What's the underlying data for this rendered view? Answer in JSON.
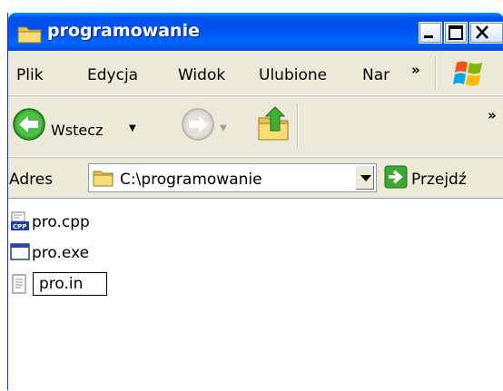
{
  "window": {
    "title": "programowanie",
    "buttons": {
      "minimize": "minimize",
      "maximize": "maximize",
      "close": "close"
    }
  },
  "menubar": {
    "items": [
      {
        "label": "Plik"
      },
      {
        "label": "Edycja"
      },
      {
        "label": "Widok"
      },
      {
        "label": "Ulubione"
      },
      {
        "label": "Nar"
      }
    ],
    "more": "»"
  },
  "toolbar": {
    "back_label": "Wstecz",
    "more": "»"
  },
  "addressbar": {
    "label": "Adres",
    "value": "C:\\programowanie",
    "go_label": "Przejdź"
  },
  "files": [
    {
      "name": "pro.cpp",
      "icon": "cpp-file-icon"
    },
    {
      "name": "pro.exe",
      "icon": "exe-file-icon"
    },
    {
      "name": "pro.in",
      "icon": "text-file-icon",
      "selected": true
    }
  ],
  "colors": {
    "titlebar": "#0053ee",
    "chrome": "#ece9d8",
    "content": "#ffffff"
  }
}
